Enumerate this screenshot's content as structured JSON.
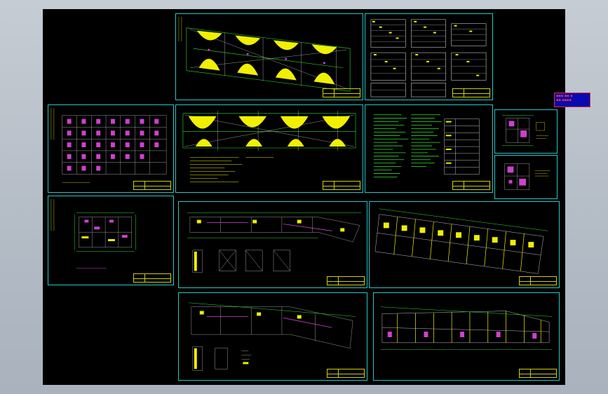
{
  "viewer": {
    "background": "#000000",
    "sheet_border_color": "#27c7c7",
    "accent_yellow": "#f0f000",
    "accent_green": "#30e030",
    "accent_magenta": "#d040d0"
  },
  "legend_panel": {
    "color": "#ff3838",
    "background": "#0a0ab0"
  },
  "sheets": [
    {
      "id": "roof-plan-top",
      "kind": "plan-with-domes"
    },
    {
      "id": "schedule-tables",
      "kind": "tables"
    },
    {
      "id": "grid-details",
      "kind": "grid"
    },
    {
      "id": "roof-plan-mid",
      "kind": "plan-with-domes"
    },
    {
      "id": "notes-sheet",
      "kind": "notes"
    },
    {
      "id": "small-detail-a",
      "kind": "detail"
    },
    {
      "id": "small-detail-b",
      "kind": "detail"
    },
    {
      "id": "unit-plan",
      "kind": "unit"
    },
    {
      "id": "floor-plan-1",
      "kind": "floor"
    },
    {
      "id": "floor-plan-2",
      "kind": "skewed-floor"
    },
    {
      "id": "floor-plan-3",
      "kind": "floor"
    },
    {
      "id": "floor-plan-4",
      "kind": "skewed-floor"
    }
  ]
}
